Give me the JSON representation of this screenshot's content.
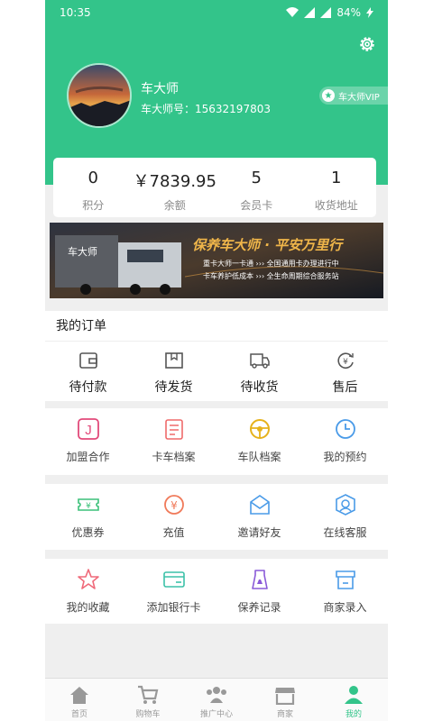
{
  "status": {
    "time": "10:35",
    "battery": "84%"
  },
  "profile": {
    "name": "车大师",
    "account": "车大师号：15632197803",
    "vip": "车大师VIP"
  },
  "stats": [
    {
      "value": "0",
      "label": "积分"
    },
    {
      "value": "￥7839.95",
      "label": "余额"
    },
    {
      "value": "5",
      "label": "会员卡"
    },
    {
      "value": "1",
      "label": "收货地址"
    }
  ],
  "banner": {
    "headline": "保养车大师 · 平安万里行",
    "line1": "重卡大师一卡通 ››› 全国通用卡办理进行中",
    "line2": "卡车养护低成本 ››› 全生命周期综合服务站",
    "logo": "车大师"
  },
  "orders": {
    "title": "我的订单",
    "items": [
      {
        "label": "待付款",
        "icon": "wallet-icon"
      },
      {
        "label": "待发货",
        "icon": "box-icon"
      },
      {
        "label": "待收货",
        "icon": "truck-icon"
      },
      {
        "label": "售后",
        "icon": "after-sale-icon"
      }
    ]
  },
  "services": [
    [
      {
        "label": "加盟合作",
        "icon": "join-icon"
      },
      {
        "label": "卡车档案",
        "icon": "truck-file-icon"
      },
      {
        "label": "车队档案",
        "icon": "steering-wheel-icon"
      },
      {
        "label": "我的预约",
        "icon": "clock-icon"
      }
    ],
    [
      {
        "label": "优惠券",
        "icon": "coupon-icon"
      },
      {
        "label": "充值",
        "icon": "recharge-icon"
      },
      {
        "label": "邀请好友",
        "icon": "invite-icon"
      },
      {
        "label": "在线客服",
        "icon": "service-icon"
      }
    ],
    [
      {
        "label": "我的收藏",
        "icon": "star-icon"
      },
      {
        "label": "添加银行卡",
        "icon": "bank-card-icon"
      },
      {
        "label": "保养记录",
        "icon": "maintenance-icon"
      },
      {
        "label": "商家录入",
        "icon": "shop-entry-icon"
      }
    ]
  ],
  "tabs": [
    {
      "label": "首页",
      "icon": "home-icon"
    },
    {
      "label": "购物车",
      "icon": "cart-icon"
    },
    {
      "label": "推广中心",
      "icon": "promotion-icon"
    },
    {
      "label": "商家",
      "icon": "store-icon"
    },
    {
      "label": "我的",
      "icon": "profile-icon"
    }
  ],
  "colors": {
    "accent": "#33c48a",
    "background": "#efefef"
  }
}
